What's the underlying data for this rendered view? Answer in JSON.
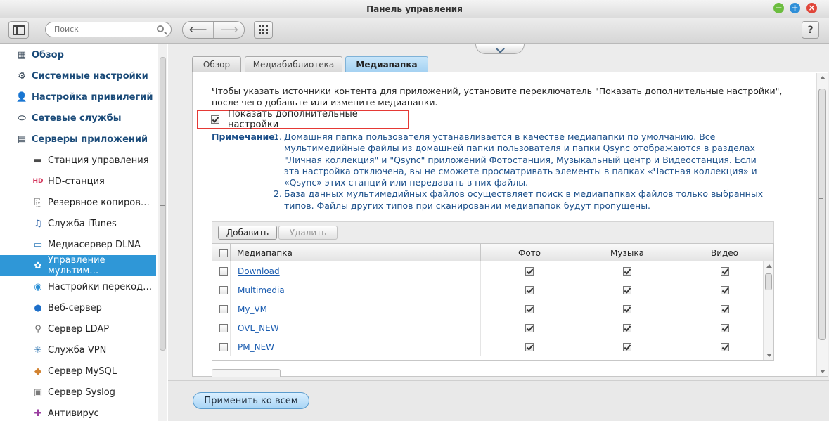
{
  "window": {
    "title": "Панель управления"
  },
  "toolbar": {
    "search_placeholder": "Поиск",
    "help_label": "?"
  },
  "sidebar": {
    "items": [
      {
        "label": "Обзор",
        "level": "top",
        "icon": "overview-icon"
      },
      {
        "label": "Системные настройки",
        "level": "top",
        "icon": "gear-icon"
      },
      {
        "label": "Настройка привилегий",
        "level": "top",
        "icon": "user-icon"
      },
      {
        "label": "Сетевые службы",
        "level": "top",
        "icon": "network-icon"
      },
      {
        "label": "Серверы приложений",
        "level": "top",
        "icon": "server-icon"
      },
      {
        "label": "Станция управления",
        "level": "sub",
        "icon": "station-icon"
      },
      {
        "label": "HD-станция",
        "level": "sub",
        "icon": "hd-station-icon"
      },
      {
        "label": "Резервное копиров…",
        "level": "sub",
        "icon": "backup-icon"
      },
      {
        "label": "Служба iTunes",
        "level": "sub",
        "icon": "itunes-icon"
      },
      {
        "label": "Медиасервер DLNA",
        "level": "sub",
        "icon": "dlna-icon"
      },
      {
        "label": "Управление мультим…",
        "level": "sub",
        "icon": "multimedia-icon",
        "active": true
      },
      {
        "label": "Настройки перекод…",
        "level": "sub",
        "icon": "transcode-icon"
      },
      {
        "label": "Веб-сервер",
        "level": "sub",
        "icon": "web-server-icon"
      },
      {
        "label": "Сервер LDAP",
        "level": "sub",
        "icon": "ldap-icon"
      },
      {
        "label": "Служба VPN",
        "level": "sub",
        "icon": "vpn-icon"
      },
      {
        "label": "Сервер MySQL",
        "level": "sub",
        "icon": "mysql-icon"
      },
      {
        "label": "Сервер Syslog",
        "level": "sub",
        "icon": "syslog-icon"
      },
      {
        "label": "Антивирус",
        "level": "sub",
        "icon": "antivirus-icon"
      }
    ]
  },
  "tabs": [
    {
      "label": "Обзор"
    },
    {
      "label": "Медиабиблиотека"
    },
    {
      "label": "Медиапапка",
      "active": true
    }
  ],
  "panel": {
    "intro": "Чтобы указать источники контента для приложений, установите переключатель \"Показать дополнительные настройки\", после чего добавьте или измените медиапапки.",
    "show_advanced": {
      "label": "Показать дополнительные настройки",
      "checked": true
    },
    "note": {
      "head": "Примечание:",
      "items": [
        {
          "num": "1.",
          "text": "Домашняя папка пользователя устанавливается в качестве медиапапки по умолчанию. Все мультимедийные файлы из домашней папки пользователя и папки Qsync отображаются в разделах \"Личная коллекция\" и \"Qsync\" приложений Фотостанция, Музыкальный центр и Видеостанция. Если эта настройка отключена, вы не сможете просматривать элементы в папках «Частная коллекция» и «Qsync» этих станций или передавать в них файлы."
        },
        {
          "num": "2.",
          "text": "База данных мультимедийных файлов осуществляет поиск в медиапапках файлов только выбранных типов. Файлы других типов при сканировании медиапапок будут пропущены."
        }
      ]
    },
    "buttons": {
      "add": "Добавить",
      "delete": "Удалить"
    },
    "table": {
      "columns": {
        "folder": "Медиапапка",
        "photo": "Фото",
        "music": "Музыка",
        "video": "Видео"
      },
      "rows": [
        {
          "folder": "Download",
          "photo": true,
          "music": true,
          "video": true
        },
        {
          "folder": "Multimedia",
          "photo": true,
          "music": true,
          "video": true
        },
        {
          "folder": "My_VM",
          "photo": true,
          "music": true,
          "video": true
        },
        {
          "folder": "OVL_NEW",
          "photo": true,
          "music": true,
          "video": true
        },
        {
          "folder": "PM_NEW",
          "photo": true,
          "music": true,
          "video": true
        }
      ]
    }
  },
  "footer": {
    "apply_all": "Применить ко всем"
  },
  "colors": {
    "accent": "#2f97d7",
    "highlight_border": "#e53935",
    "note_text": "#1b4f8a",
    "link": "#1a5cb0"
  }
}
